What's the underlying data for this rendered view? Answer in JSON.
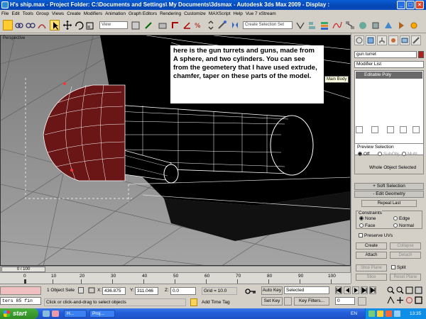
{
  "window": {
    "title": "H's ship.max - Project Folder: C:\\Documents and Settings\\                  My Documents\\3dsmax    - Autodesk 3ds Max  2009         - Display :"
  },
  "menu": [
    "File",
    "Edit",
    "Tools",
    "Group",
    "Views",
    "Create",
    "Modifiers",
    "Animation",
    "Graph Editors",
    "Rendering",
    "Customize",
    "MAXScript",
    "Help",
    "Vue 7 xStream"
  ],
  "toolbar": {
    "view_dropdown": "View",
    "selection_set": "Create Selection Set"
  },
  "viewport": {
    "label": "Perspective",
    "annotation": "here is the gun turrets and guns, made from A sphere, and two cylinders. You can see from the geometery that I have used extrude, chamfer, taper on these parts of the model.",
    "tooltip": "Main Body"
  },
  "command_panel": {
    "object_name": "gun turret",
    "modifier_list": "Modifier List",
    "stack_item": "Editable Poly",
    "preview_selection": "Preview Selection",
    "preview_off": "Off",
    "preview_subobj": "SubObj",
    "preview_multi": "Multi",
    "whole_object": "Whole Object Selected",
    "soft_selection": "Soft Selection",
    "edit_geometry": "Edit Geometry",
    "repeat_last": "Repeat Last",
    "constraints": "Constraints",
    "none": "None",
    "edge": "Edge",
    "face": "Face",
    "normal": "Normal",
    "preserve_uvs": "Preserve UVs",
    "create": "Create",
    "collapse": "Collapse",
    "attach": "Attach",
    "detach": "Detach",
    "slice_plane": "Slice Plane",
    "split": "Split",
    "slice": "Slice",
    "reset_plane": "Reset Plane"
  },
  "timeline": {
    "frame": "0 / 100",
    "ticks": [
      "0",
      "10",
      "20",
      "30",
      "40",
      "50",
      "60",
      "70",
      "80",
      "90",
      "100"
    ]
  },
  "status": {
    "maxscript": "ters 85 fin",
    "selection": "1 Object Sele",
    "x_label": "X:",
    "x_value": "436.875",
    "y_label": "Y:",
    "y_value": "311.046",
    "z_label": "Z:",
    "z_value": "0.0",
    "grid": "Grid = 10.0",
    "auto_key": "Auto Key",
    "key_mode": "Selected",
    "set_key": "Set Key",
    "key_filters": "Key Filters...",
    "frame_field": "0",
    "prompt": "Click or click-and-drag to select objects",
    "add_time_tag": "Add Time Tag"
  },
  "taskbar": {
    "start": "start",
    "task1": "H...",
    "task2": "Proj...",
    "lang": "EN",
    "clock": "13:35"
  }
}
